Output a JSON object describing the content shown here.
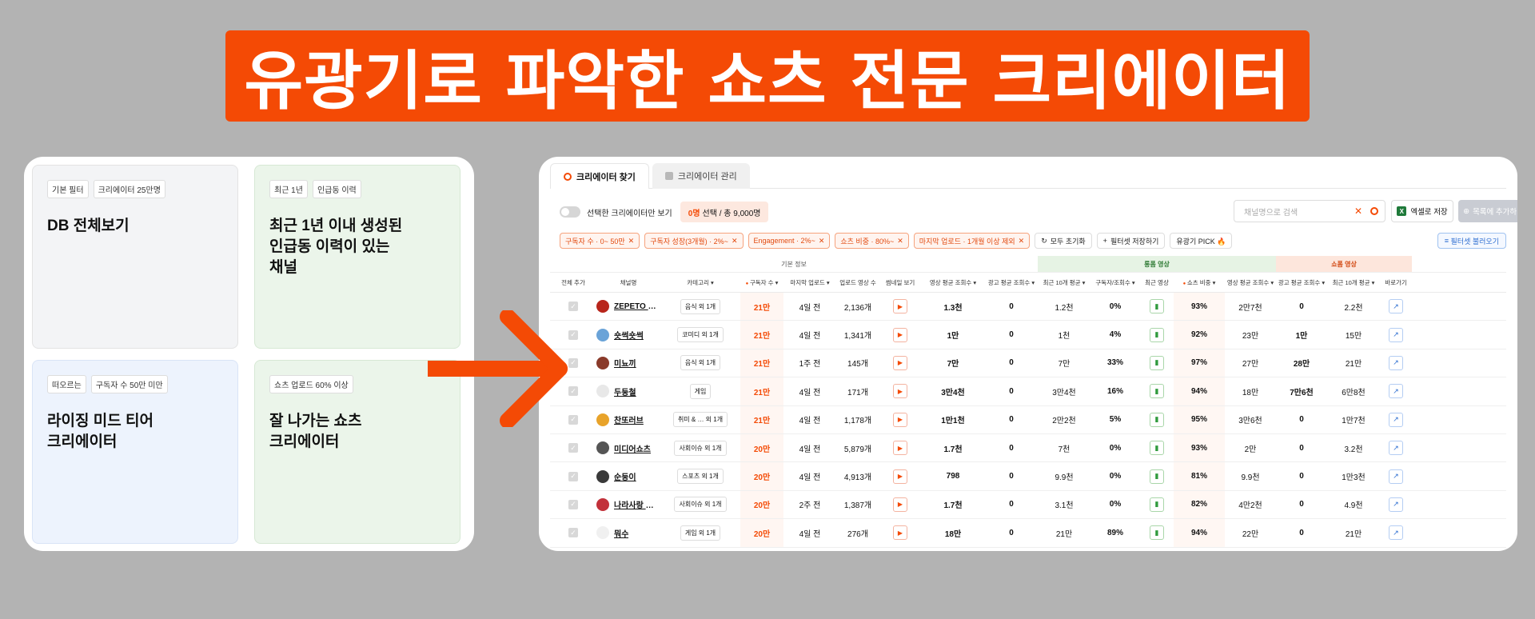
{
  "banner": {
    "title": "유광기로 파악한 쇼츠 전문 크리에이터"
  },
  "left_cards": [
    {
      "tags": [
        "기본 필터",
        "크리에이터 25만명"
      ],
      "title": "DB 전체보기"
    },
    {
      "tags": [
        "최근 1년",
        "인급동 이력"
      ],
      "title": "최근 1년 이내 생성된\n인급동 이력이 있는\n채널"
    },
    {
      "tags": [
        "떠오르는",
        "구독자 수 50만 미만"
      ],
      "title": "라이징 미드 티어\n크리에이터"
    },
    {
      "tags": [
        "쇼츠 업로드 60% 이상"
      ],
      "title": "잘 나가는 쇼츠\n크리에이터"
    }
  ],
  "tabs": [
    {
      "label": "크리에이터 찾기",
      "active": true,
      "icon": "search-icon"
    },
    {
      "label": "크리에이터 관리",
      "active": false,
      "icon": "folder-icon"
    }
  ],
  "toolbar": {
    "toggle_label": "선택한 크리에이터만 보기",
    "selected_count": "0명",
    "selected_rest": "선택 / 총 9,000명",
    "search_placeholder": "채널명으로 검색",
    "excel_label": "엑셀로 저장",
    "add_list_label": "목록에 추가하기"
  },
  "filters": {
    "chips": [
      "구독자 수 · 0~ 50만",
      "구독자 성장(3개월) · 2%~",
      "Engagement · 2%~",
      "쇼츠 비중 · 80%~",
      "마지막 업로드 · 1개월 이상 제외"
    ],
    "reset_label": "모두 초기화",
    "save_preset_label": "필터셋 저장하기",
    "pick_label": "유광기 PICK 🔥",
    "load_preset_label": "필터셋 불러오기"
  },
  "table": {
    "groups": {
      "basic": "기본 정보",
      "long": "롱폼 영상",
      "short": "쇼폼 영상"
    },
    "headers": [
      "전체 추가",
      "채널명",
      "카테고리 ▾",
      "구독자 수 ▾",
      "마지막 업로드 ▾",
      "업로드 영상 수",
      "썸네일 보기",
      "영상 평균 조회수 ▾",
      "광고 평균 조회수 ▾",
      "최근 10개 평균 ▾",
      "구독자/조회수 ▾",
      "최근 영상",
      "쇼츠 비중 ▾",
      "영상 평균 조회수 ▾",
      "광고 평균 조회수 ▾",
      "최근 10개 평균 ▾",
      "바로가기"
    ],
    "rows": [
      {
        "name": "ZEPETO WOR…",
        "category": "음식 외 1개",
        "subs": "21만",
        "last": "4일 전",
        "uploads": "2,136개",
        "l_avg": "1.3천",
        "l_ad": "0",
        "l_recent": "1.2천",
        "ratio": "0%",
        "short_pct": "93%",
        "s_avg": "2만7천",
        "s_ad": "0",
        "s_recent": "2.2천",
        "avatar": "#b8251b"
      },
      {
        "name": "숏썩숏썩",
        "category": "코미디 외 1개",
        "subs": "21만",
        "last": "4일 전",
        "uploads": "1,341개",
        "l_avg": "1만",
        "l_ad": "0",
        "l_recent": "1천",
        "ratio": "4%",
        "short_pct": "92%",
        "s_avg": "23만",
        "s_ad": "1만",
        "s_recent": "15만",
        "avatar": "#6aa3d8"
      },
      {
        "name": "미뇨끼",
        "category": "음식 외 1개",
        "subs": "21만",
        "last": "1주 전",
        "uploads": "145개",
        "l_avg": "7만",
        "l_ad": "0",
        "l_recent": "7만",
        "ratio": "33%",
        "short_pct": "97%",
        "s_avg": "27만",
        "s_ad": "28만",
        "s_recent": "21만",
        "avatar": "#8a3a2a"
      },
      {
        "name": "두둥철",
        "category": "게임",
        "subs": "21만",
        "last": "4일 전",
        "uploads": "171개",
        "l_avg": "3만4천",
        "l_ad": "0",
        "l_recent": "3만4천",
        "ratio": "16%",
        "short_pct": "94%",
        "s_avg": "18만",
        "s_ad": "7만6천",
        "s_recent": "6만8천",
        "avatar": "#e8e8e8"
      },
      {
        "name": "찬또러브",
        "category": "취미 & … 외 1개",
        "subs": "21만",
        "last": "4일 전",
        "uploads": "1,178개",
        "l_avg": "1만1천",
        "l_ad": "0",
        "l_recent": "2만2천",
        "ratio": "5%",
        "short_pct": "95%",
        "s_avg": "3만6천",
        "s_ad": "0",
        "s_recent": "1만7천",
        "avatar": "#e8a32a"
      },
      {
        "name": "미디어쇼츠",
        "category": "사회이슈 외 1개",
        "subs": "20만",
        "last": "4일 전",
        "uploads": "5,879개",
        "l_avg": "1.7천",
        "l_ad": "0",
        "l_recent": "7천",
        "ratio": "0%",
        "short_pct": "93%",
        "s_avg": "2만",
        "s_ad": "0",
        "s_recent": "3.2천",
        "avatar": "#555555"
      },
      {
        "name": "순둥이",
        "category": "스포츠 외 1개",
        "subs": "20만",
        "last": "4일 전",
        "uploads": "4,913개",
        "l_avg": "798",
        "l_ad": "0",
        "l_recent": "9.9천",
        "ratio": "0%",
        "short_pct": "81%",
        "s_avg": "9.9천",
        "s_ad": "0",
        "s_recent": "1만3천",
        "avatar": "#3a3a3a"
      },
      {
        "name": "나라사랑 청년정…",
        "category": "사회이슈 외 1개",
        "subs": "20만",
        "last": "2주 전",
        "uploads": "1,387개",
        "l_avg": "1.7천",
        "l_ad": "0",
        "l_recent": "3.1천",
        "ratio": "0%",
        "short_pct": "82%",
        "s_avg": "4만2천",
        "s_ad": "0",
        "s_recent": "4.9천",
        "avatar": "#c2313a"
      },
      {
        "name": "뭐수",
        "category": "게임 외 1개",
        "subs": "20만",
        "last": "4일 전",
        "uploads": "276개",
        "l_avg": "18만",
        "l_ad": "0",
        "l_recent": "21만",
        "ratio": "89%",
        "short_pct": "94%",
        "s_avg": "22만",
        "s_ad": "0",
        "s_recent": "21만",
        "avatar": "#f0f0f0"
      }
    ]
  },
  "colors": {
    "brand": "#f44a05",
    "long_group": "#e6f3e4",
    "short_group": "#fde6dc"
  }
}
